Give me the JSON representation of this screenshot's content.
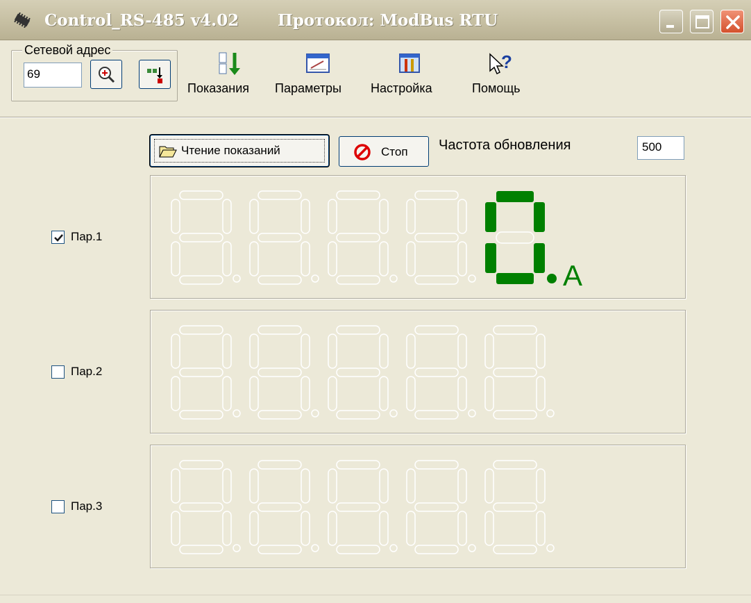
{
  "window": {
    "title": "Control_RS-485 v4.02",
    "protocol": "Протокол: ModBus RTU"
  },
  "toolbar": {
    "address_group_label": "Сетевой адрес",
    "address_value": "69",
    "search_icon": "zoom-in-icon",
    "transfer_icon": "transfer-icon",
    "items": [
      {
        "label": "Показания",
        "icon": "readings-icon"
      },
      {
        "label": "Параметры",
        "icon": "parameters-icon"
      },
      {
        "label": "Настройка",
        "icon": "settings-icon"
      },
      {
        "label": "Помощь",
        "icon": "help-icon"
      }
    ]
  },
  "controls": {
    "read_button": "Чтение показаний",
    "stop_button": "Стоп",
    "freq_label": "Частота обновления",
    "freq_value": "500"
  },
  "channels": [
    {
      "label": "Пар.1",
      "checked": true,
      "value": "0",
      "unit": "А"
    },
    {
      "label": "Пар.2",
      "checked": false,
      "value": "",
      "unit": ""
    },
    {
      "label": "Пар.3",
      "checked": false,
      "value": "",
      "unit": ""
    }
  ],
  "colors": {
    "display_active": "#008000",
    "display_ghost": "#ffffff",
    "face": "#ece9d8"
  }
}
